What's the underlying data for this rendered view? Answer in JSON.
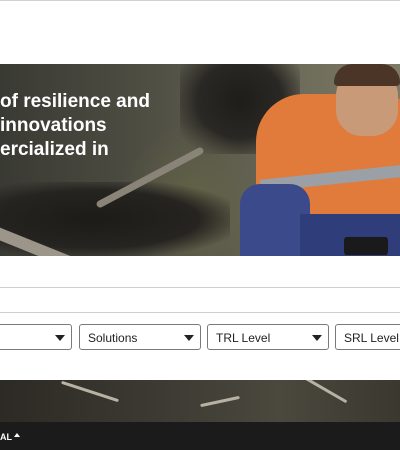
{
  "hero": {
    "title_lines": [
      "of resilience and",
      "innovations",
      "ercialized in"
    ]
  },
  "filters": {
    "first": {
      "label": ""
    },
    "solutions": {
      "label": "Solutions"
    },
    "trl": {
      "label": "TRL Level"
    },
    "srl": {
      "label": "SRL Level"
    }
  },
  "footer": {
    "label": "AL"
  }
}
